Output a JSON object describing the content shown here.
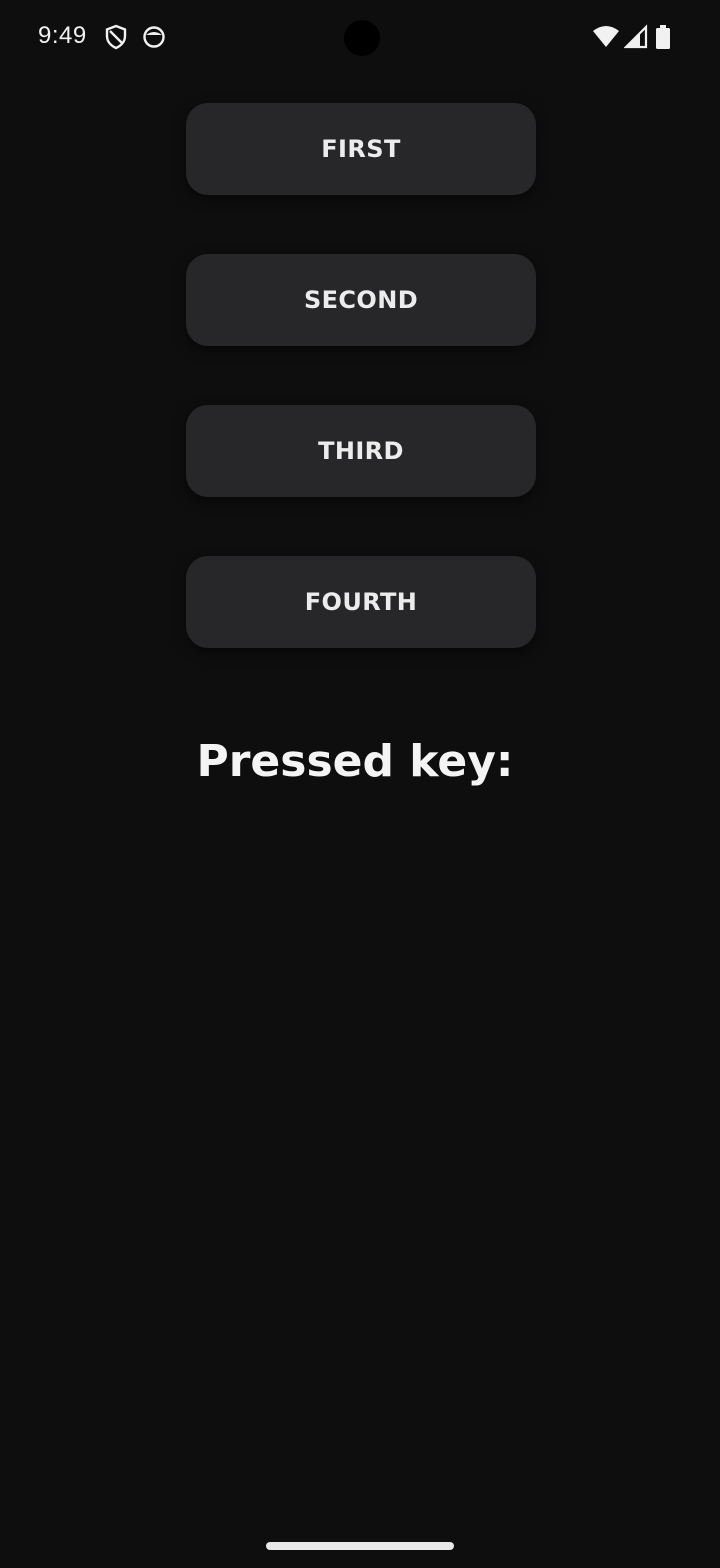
{
  "status_bar": {
    "time": "9:49",
    "left_icons": [
      "shield-icon",
      "app-circle-icon"
    ],
    "right_icons": [
      "wifi-icon",
      "signal-icon",
      "battery-icon"
    ]
  },
  "buttons": [
    {
      "label": "FIRST"
    },
    {
      "label": "SECOND"
    },
    {
      "label": "THIRD"
    },
    {
      "label": "FOURTH"
    }
  ],
  "pressed_key": {
    "label": "Pressed key:",
    "value": ""
  },
  "colors": {
    "background": "#0e0e0f",
    "button_bg": "#272729",
    "text": "#ececec"
  }
}
